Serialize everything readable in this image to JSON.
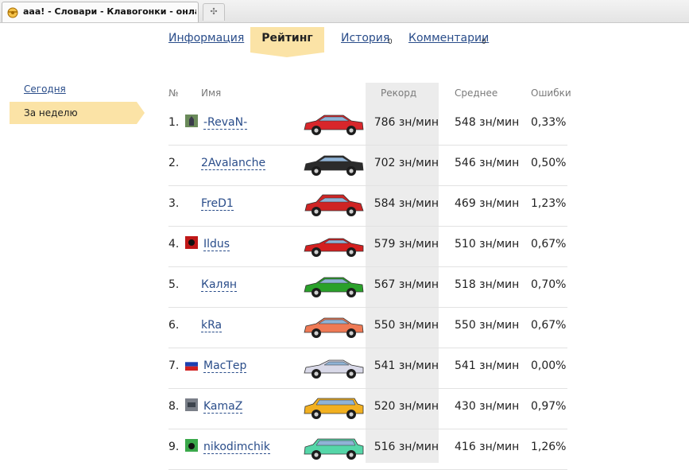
{
  "browser": {
    "tab_title": "aaa! - Словари - Клавогонки - онлай..."
  },
  "nav": {
    "info": "Информация",
    "rating": "Рейтинг",
    "history": "История",
    "history_count": "0",
    "comments": "Комментарии",
    "comments_count": "0"
  },
  "period": {
    "today": "Сегодня",
    "week": "За неделю"
  },
  "table": {
    "headers": {
      "num": "№",
      "name": "Имя",
      "record": "Рекорд",
      "average": "Среднее",
      "errors": "Ошибки"
    },
    "rows": [
      {
        "num": "1.",
        "name": "-RevaN-",
        "record": "786 зн/мин",
        "average": "548 зн/мин",
        "errors": "0,33%",
        "avatar": "knight-avatar-icon",
        "car_color": "#d8262b",
        "car_style": "sedan"
      },
      {
        "num": "2.",
        "name": "2Avalanche",
        "record": "702 зн/мин",
        "average": "546 зн/мин",
        "errors": "0,50%",
        "avatar": "",
        "car_color": "#2b2b2b",
        "car_style": "sedan"
      },
      {
        "num": "3.",
        "name": "FreD1",
        "record": "584 зн/мин",
        "average": "469 зн/мин",
        "errors": "1,23%",
        "avatar": "",
        "car_color": "#cf2424",
        "car_style": "hatch"
      },
      {
        "num": "4.",
        "name": "Ildus",
        "record": "579 зн/мин",
        "average": "510 зн/мин",
        "errors": "0,67%",
        "avatar": "red-emblem-avatar-icon",
        "car_color": "#d42020",
        "car_style": "sport"
      },
      {
        "num": "5.",
        "name": "Калян",
        "record": "567 зн/мин",
        "average": "518 зн/мин",
        "errors": "0,70%",
        "avatar": "",
        "car_color": "#2aa12a",
        "car_style": "sedan"
      },
      {
        "num": "6.",
        "name": "kRa",
        "record": "550 зн/мин",
        "average": "550 зн/мин",
        "errors": "0,67%",
        "avatar": "",
        "car_color": "#ef7a55",
        "car_style": "sedan"
      },
      {
        "num": "7.",
        "name": "МасТер",
        "record": "541 зн/мин",
        "average": "541 зн/мин",
        "errors": "0,00%",
        "avatar": "russian-flag-avatar-icon",
        "car_color": "#d9d9e8",
        "car_style": "sport"
      },
      {
        "num": "8.",
        "name": "KamaZ",
        "record": "520 зн/мин",
        "average": "430 зн/мин",
        "errors": "0,97%",
        "avatar": "photo-avatar-icon",
        "car_color": "#f2b020",
        "car_style": "wagon"
      },
      {
        "num": "9.",
        "name": "nikodimchik",
        "record": "516 зн/мин",
        "average": "416 зн/мин",
        "errors": "1,26%",
        "avatar": "green-avatar-icon",
        "car_color": "#55d6a8",
        "car_style": "wagon"
      }
    ]
  }
}
